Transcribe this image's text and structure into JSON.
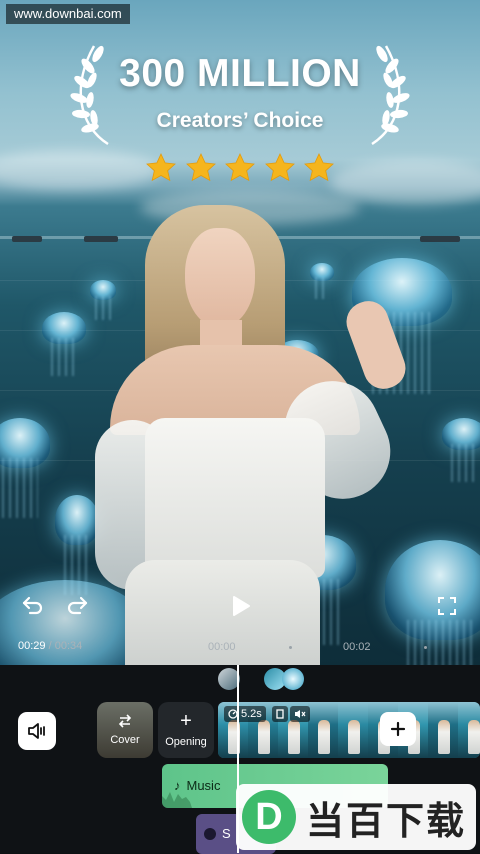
{
  "watermark": {
    "site": "www.downbai.com"
  },
  "promo": {
    "headline": "300 MILLION",
    "subheadline": "Creators’ Choice",
    "rating_stars": 5,
    "star_color": "#f5b51d"
  },
  "player": {
    "current_time": "00:29",
    "separator": " / ",
    "total_time": "00:34",
    "ruler_marks": [
      "00:00",
      "00:02"
    ]
  },
  "editor": {
    "cover_label": "Cover",
    "opening_label": "Opening",
    "clip_duration": "5.2s",
    "music_label": "Music",
    "second_track_letter": "S",
    "accent_green": "#6ccc91",
    "accent_purple": "#5a4f86"
  },
  "logo": {
    "mark": "D",
    "text": "当百下载"
  }
}
